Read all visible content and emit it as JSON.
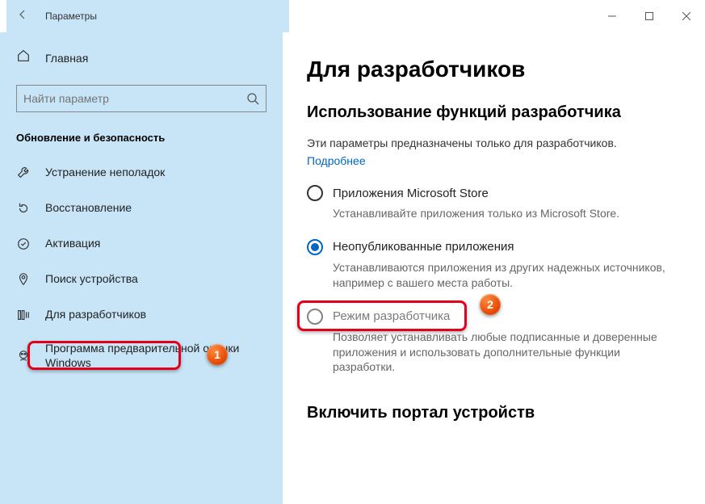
{
  "window": {
    "title": "Параметры"
  },
  "sidebar": {
    "home": "Главная",
    "search_placeholder": "Найти параметр",
    "section": "Обновление и безопасность",
    "items": [
      {
        "label": "Устранение неполадок"
      },
      {
        "label": "Восстановление"
      },
      {
        "label": "Активация"
      },
      {
        "label": "Поиск устройства"
      },
      {
        "label": "Для разработчиков"
      },
      {
        "label": "Программа предварительной оценки Windows"
      }
    ]
  },
  "main": {
    "heading": "Для разработчиков",
    "sub1": "Использование функций разработчика",
    "desc": "Эти параметры предназначены только для разработчиков.",
    "more": "Подробнее",
    "radios": [
      {
        "label": "Приложения Microsoft Store",
        "desc": "Устанавливайте приложения только из Microsoft Store."
      },
      {
        "label": "Неопубликованные приложения",
        "desc": "Устанавливаются приложения из других надежных источников, например с вашего места работы."
      },
      {
        "label": "Режим разработчика",
        "desc": "Позволяет устанавливать любые подписанные и доверенные приложения и использовать дополнительные функции разработки."
      }
    ],
    "sub2": "Включить портал устройств"
  },
  "annotations": {
    "b1": "1",
    "b2": "2"
  }
}
